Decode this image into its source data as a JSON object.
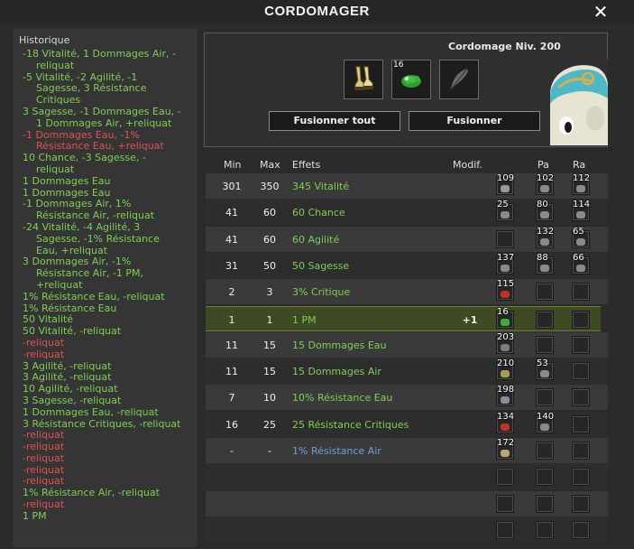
{
  "window": {
    "title": "CORDOMAGER",
    "close_label": "✕"
  },
  "history": {
    "title": "Historique",
    "entries": [
      {
        "lines": [
          "-18 Vitalité, 1 Dommages Air, -",
          "reliquat"
        ],
        "color": "green"
      },
      {
        "lines": [
          "-5 Vitalité, -2 Agilité, -1",
          "Sagesse, 3 Résistance",
          "Critiques"
        ],
        "color": "green"
      },
      {
        "lines": [
          "3 Sagesse, -1 Dommages Eau, -",
          "1 Dommages Air, +reliquat"
        ],
        "color": "green"
      },
      {
        "lines": [
          "-1 Dommages Eau, -1%",
          "Résistance Eau, +reliquat"
        ],
        "color": "red"
      },
      {
        "lines": [
          "10 Chance, -3 Sagesse, -",
          "reliquat"
        ],
        "color": "green"
      },
      {
        "lines": [
          "1 Dommages Eau"
        ],
        "color": "green"
      },
      {
        "lines": [
          "1 Dommages Eau"
        ],
        "color": "green"
      },
      {
        "lines": [
          "-1 Dommages Air, 1%",
          "Résistance Air, -reliquat"
        ],
        "color": "green"
      },
      {
        "lines": [
          "-24 Vitalité, -4 Agilité, 3",
          "Sagesse, -1% Résistance",
          "Eau, +reliquat"
        ],
        "color": "green"
      },
      {
        "lines": [
          "3 Dommages Air, -1%",
          "Résistance Air, -1 PM,",
          "+reliquat"
        ],
        "color": "green"
      },
      {
        "lines": [
          "1% Résistance Eau, -reliquat"
        ],
        "color": "green"
      },
      {
        "lines": [
          "1% Résistance Eau"
        ],
        "color": "green"
      },
      {
        "lines": [
          "50 Vitalité"
        ],
        "color": "green"
      },
      {
        "lines": [
          "50 Vitalité, -reliquat"
        ],
        "color": "green"
      },
      {
        "lines": [
          "-reliquat"
        ],
        "color": "red"
      },
      {
        "lines": [
          "-reliquat"
        ],
        "color": "red"
      },
      {
        "lines": [
          "3 Agilité, -reliquat"
        ],
        "color": "green"
      },
      {
        "lines": [
          "3 Agilité, -reliquat"
        ],
        "color": "green"
      },
      {
        "lines": [
          "10 Agilité, -reliquat"
        ],
        "color": "green"
      },
      {
        "lines": [
          "3 Sagesse, -reliquat"
        ],
        "color": "green"
      },
      {
        "lines": [
          "1 Dommages Eau, -reliquat"
        ],
        "color": "green"
      },
      {
        "lines": [
          "3 Résistance Critiques, -reliquat"
        ],
        "color": "green"
      },
      {
        "lines": [
          "-reliquat"
        ],
        "color": "red"
      },
      {
        "lines": [
          "-reliquat"
        ],
        "color": "red"
      },
      {
        "lines": [
          "-reliquat"
        ],
        "color": "red"
      },
      {
        "lines": [
          "-reliquat"
        ],
        "color": "red"
      },
      {
        "lines": [
          "-reliquat"
        ],
        "color": "red"
      },
      {
        "lines": [
          "1% Résistance Air, -reliquat"
        ],
        "color": "green"
      },
      {
        "lines": [
          "-reliquat"
        ],
        "color": "red"
      },
      {
        "lines": [
          "1 PM"
        ],
        "color": "green"
      }
    ]
  },
  "craft": {
    "level_label": "Cordomage Niv. 200",
    "slots": [
      {
        "icon": "boots-item-icon",
        "qty": ""
      },
      {
        "icon": "green-rune-icon",
        "qty": "16"
      },
      {
        "icon": "feather-icon",
        "qty": ""
      }
    ],
    "fuse_all_label": "Fusionner tout",
    "fuse_label": "Fusionner"
  },
  "table": {
    "headers": {
      "min": "Min",
      "max": "Max",
      "effects": "Effets",
      "modif": "Modif.",
      "pa": "Pa",
      "ra": "Ra"
    },
    "rows": [
      {
        "min": "301",
        "max": "350",
        "effect": "345 Vitalité",
        "modif": "",
        "rune": "109",
        "pa": "102",
        "ra": "112",
        "gem": "#9a9a9a"
      },
      {
        "min": "41",
        "max": "60",
        "effect": "60 Chance",
        "modif": "",
        "rune": "25",
        "pa": "80",
        "ra": "114",
        "gem": "#8a8a8a"
      },
      {
        "min": "41",
        "max": "60",
        "effect": "60 Agilité",
        "modif": "",
        "rune": "",
        "pa": "132",
        "ra": "65",
        "gem": ""
      },
      {
        "min": "31",
        "max": "50",
        "effect": "50 Sagesse",
        "modif": "",
        "rune": "137",
        "pa": "88",
        "ra": "66",
        "gem": "#8a8a8a"
      },
      {
        "min": "2",
        "max": "3",
        "effect": "3% Critique",
        "modif": "",
        "rune": "115",
        "pa": "",
        "ra": "",
        "gem": "#c0302a"
      },
      {
        "min": "1",
        "max": "1",
        "effect": "1 PM",
        "modif": "+1",
        "rune": "16",
        "pa": "",
        "ra": "",
        "gem": "#3fae3a"
      },
      {
        "min": "11",
        "max": "15",
        "effect": "15 Dommages Eau",
        "modif": "",
        "rune": "203",
        "pa": "",
        "ra": "",
        "gem": "#7a7a7a"
      },
      {
        "min": "11",
        "max": "15",
        "effect": "15 Dommages Air",
        "modif": "",
        "rune": "210",
        "pa": "53",
        "ra": "",
        "gem": "#a89a5a"
      },
      {
        "min": "7",
        "max": "10",
        "effect": "10% Résistance Eau",
        "modif": "",
        "rune": "198",
        "pa": "",
        "ra": "",
        "gem": "#8a8aa0"
      },
      {
        "min": "16",
        "max": "25",
        "effect": "25 Résistance Critiques",
        "modif": "",
        "rune": "134",
        "pa": "140",
        "ra": "",
        "gem": "#c0302a"
      },
      {
        "min": "-",
        "max": "-",
        "effect": "1% Résistance Air",
        "modif": "",
        "rune": "172",
        "pa": "",
        "ra": "",
        "gem": "#b8a878"
      },
      {
        "min": "",
        "max": "",
        "effect": "",
        "modif": "",
        "rune": "",
        "pa": "",
        "ra": "",
        "gem": ""
      },
      {
        "min": "",
        "max": "",
        "effect": "",
        "modif": "",
        "rune": "",
        "pa": "",
        "ra": "",
        "gem": ""
      },
      {
        "min": "",
        "max": "",
        "effect": "",
        "modif": "",
        "rune": "",
        "pa": "",
        "ra": "",
        "gem": ""
      }
    ]
  }
}
